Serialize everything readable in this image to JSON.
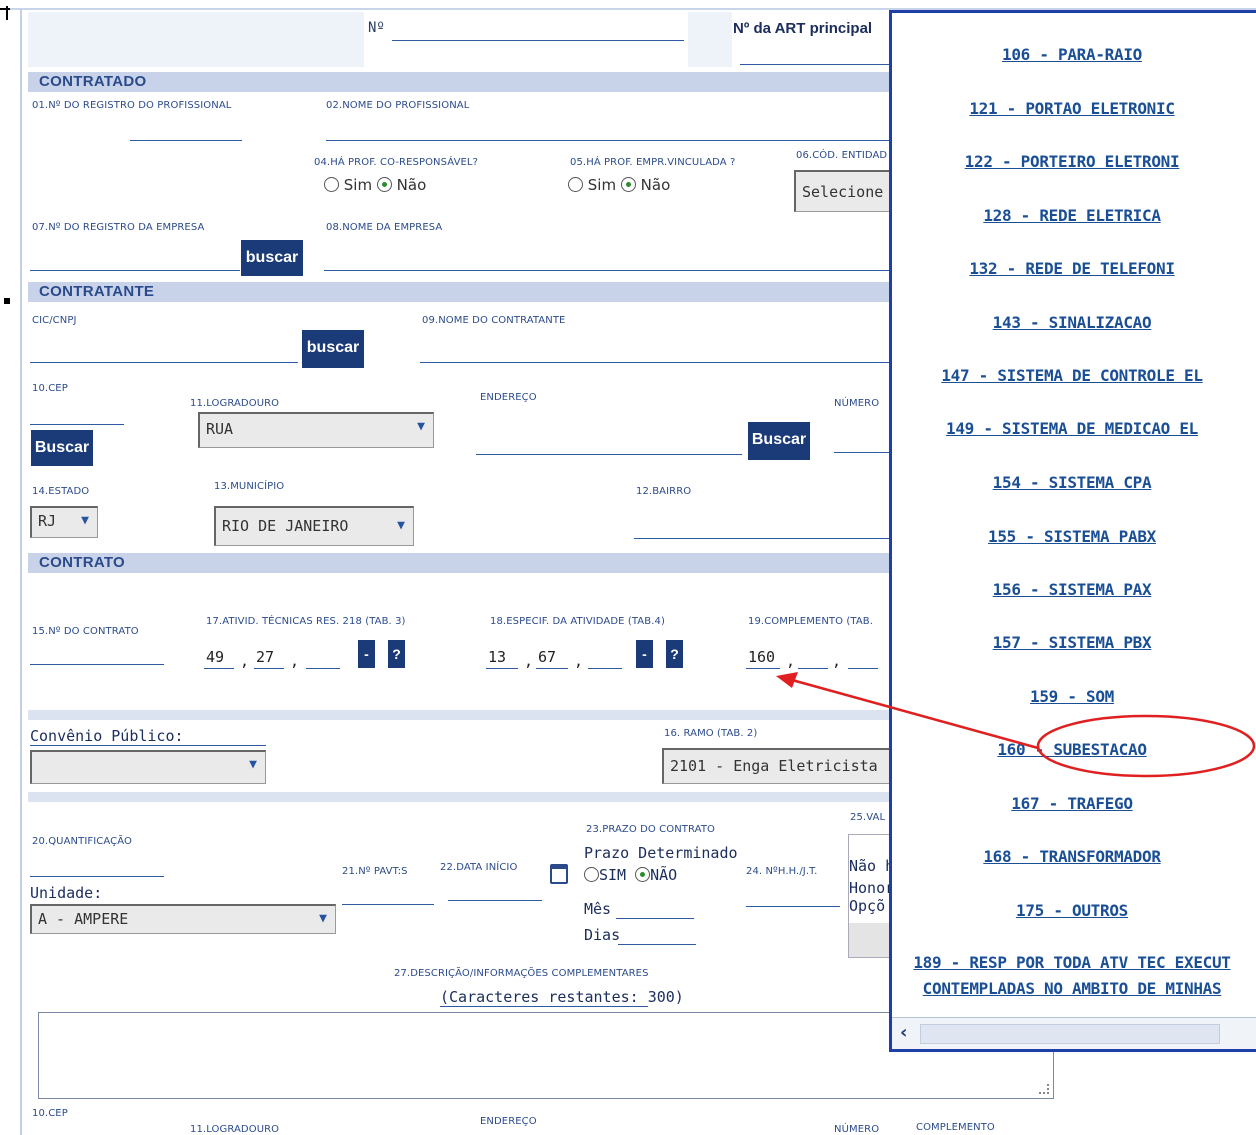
{
  "top": {
    "no_label": "Nº",
    "art_label": "Nº da ART principal"
  },
  "contratado": {
    "section": "CONTRATADO",
    "f01": "01.nº do registro do profissional",
    "f02": "02.nome do profissional",
    "f04": "04.há prof. co-responsável?",
    "f05": "05.há prof. empr.vinculada ?",
    "f06": "06.cód. entidad",
    "yes": "Sim",
    "no": "Não",
    "entidade_select": "Selecione",
    "f07": "07.nº do registro da empresa",
    "f08": "08.nome da empresa",
    "buscar": "buscar"
  },
  "contratante": {
    "section": "CONTRATANTE",
    "cic": "cic/cnpj",
    "f09": "09.nome do contratante",
    "buscar": "buscar",
    "cep": "10.cep",
    "logradouro": "11.logradouro",
    "logradouro_value": "RUA",
    "endereco": "endereço",
    "numero": "número",
    "buscar_cep": "Buscar",
    "buscar_end": "Buscar",
    "estado": "14.estado",
    "estado_value": "RJ",
    "municipio": "13.município",
    "municipio_value": "RIO DE JANEIRO",
    "bairro": "12.bairro"
  },
  "contrato": {
    "section": "CONTRATO",
    "f15": "15.nº do contrato",
    "f17": "17.ativid. técnicas res. 218 (tab. 3)",
    "f18": "18.especif. da atividade (tab.4)",
    "f19": "19.complemento (tab.",
    "f17_v1": "49",
    "f17_v2": "27",
    "f18_v1": "13",
    "f18_v2": "67",
    "f19_v1": "160",
    "comma": ",",
    "minus": "-",
    "help": "?"
  },
  "convenio": {
    "label": "Convênio Público:",
    "ramo_label": "16. ramo (tab. 2)",
    "ramo_value": "2101 - Enga Eletricista"
  },
  "quant": {
    "f20": "20.quantificação",
    "unidade": "Unidade:",
    "unidade_value": "A - AMPERE",
    "f21": "21.nº pavt:s",
    "f22": "22.data início",
    "f23": "23.prazo do contrato",
    "prazo_det": "Prazo Determinado",
    "sim": "SIM",
    "nao": "NÃO",
    "mes": "Mês",
    "dias": "Dias",
    "f24": "24. nºh.h./j.t.",
    "f25": "25.val",
    "nao_h": "Não h",
    "honor": "Honor",
    "opco": "Opçõ"
  },
  "descricao": {
    "label": "27.descrição/informações complementares",
    "remaining": "(Caracteres restantes: 300)"
  },
  "bottom": {
    "cep": "10.cep",
    "logradouro": "11.logradouro",
    "endereco": "endereço",
    "numero": "número",
    "complemento": "complemento"
  },
  "popup": {
    "items": [
      "106 - PARA-RAIO",
      "121 - PORTAO ELETRONIC",
      "122 - PORTEIRO ELETRONI",
      "128 - REDE ELETRICA",
      "132 - REDE DE TELEFONI",
      "143 - SINALIZACAO",
      "147 - SISTEMA DE CONTROLE EL",
      "149 - SISTEMA DE MEDICAO EL",
      "154 - SISTEMA CPA",
      "155 - SISTEMA PABX",
      "156 - SISTEMA PAX",
      "157 - SISTEMA PBX",
      "159 - SOM",
      "160 - SUBESTACAO",
      "167 - TRAFEGO",
      "168 - TRANSFORMADOR",
      "175 - OUTROS",
      "189 - RESP POR TODA ATV TEC EXECUT",
      "CONTEMPLADAS NO AMBITO DE MINHAS"
    ],
    "scroll_left": "‹"
  },
  "colors": {
    "link": "#1a4f96",
    "button": "#1a3a78",
    "section": "#c8d3ea",
    "annotation": "#e02020"
  }
}
